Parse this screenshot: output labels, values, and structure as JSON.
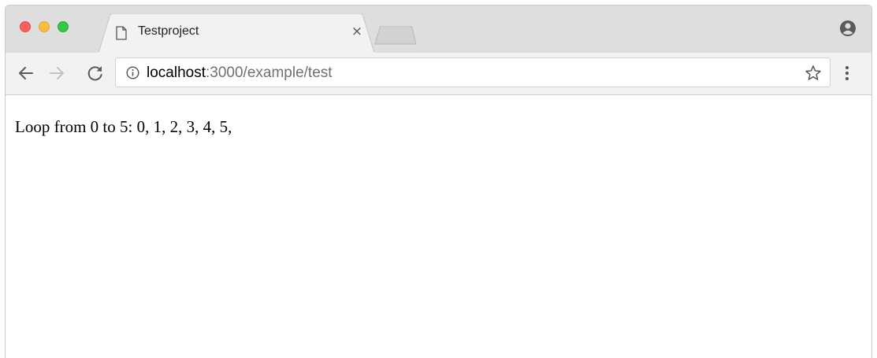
{
  "browser": {
    "tab": {
      "title": "Testproject",
      "close_glyph": "×"
    },
    "address_bar": {
      "host": "localhost",
      "rest": ":3000/example/test"
    },
    "icons": {
      "back": "back-arrow-icon",
      "forward": "forward-arrow-icon",
      "reload": "reload-icon",
      "info": "info-icon",
      "star": "star-icon",
      "menu": "menu-dots-icon",
      "profile": "profile-icon",
      "page": "page-icon"
    },
    "colors": {
      "close": "#fc605c",
      "minimize": "#fdbc40",
      "maximize": "#34c84a",
      "tab_strip": "#dedede",
      "toolbar": "#f2f2f2"
    }
  },
  "page": {
    "text": "Loop from 0 to 5: 0, 1, 2, 3, 4, 5,"
  }
}
